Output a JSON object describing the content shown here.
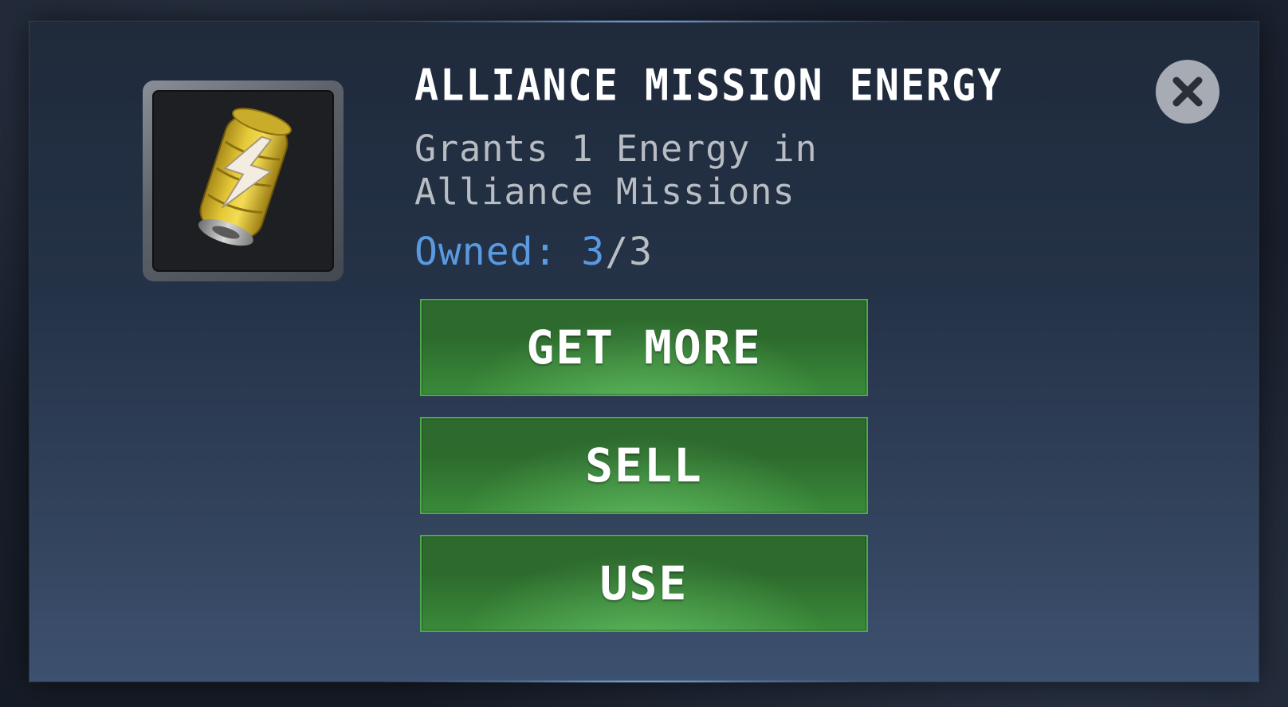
{
  "item": {
    "icon": "energy-battery-icon",
    "title": "ALLIANCE MISSION ENERGY",
    "description": "Grants 1 Energy in Alliance Missions",
    "owned_label": "Owned:",
    "owned_count": "3",
    "owned_separator": "/",
    "owned_max": "3"
  },
  "buttons": {
    "get_more": "GET MORE",
    "sell": "SELL",
    "use": "USE"
  },
  "close": {
    "icon": "close-icon"
  },
  "colors": {
    "button_green": "#2d6b2d",
    "owned_blue": "#5a9ae0",
    "panel_bg": "#243247"
  }
}
